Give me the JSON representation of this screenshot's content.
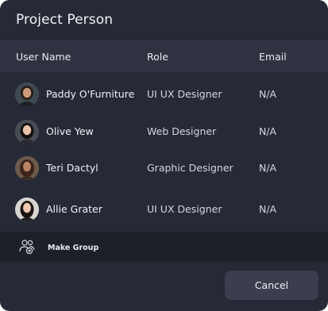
{
  "dialog": {
    "title": "Project Person",
    "columns": {
      "name": "User Name",
      "role": "Role",
      "email": "Email"
    },
    "rows": [
      {
        "name": "Paddy O'Furniture",
        "role": "UI UX Designer",
        "email": "N/A",
        "avatar_bg": "#3d4a52",
        "skin": "#c99a7c",
        "hair": "#2a1c16"
      },
      {
        "name": "Olive Yew",
        "role": "Web Designer",
        "email": "N/A",
        "avatar_bg": "#4a4c55",
        "skin": "#e8c4a8",
        "hair": "#15110f"
      },
      {
        "name": "Teri Dactyl",
        "role": "Graphic Designer",
        "email": "N/A",
        "avatar_bg": "#6e5a4c",
        "skin": "#b98464",
        "hair": "#3a2418"
      },
      {
        "name": "Allie Grater",
        "role": "UI UX Designer",
        "email": "N/A",
        "avatar_bg": "#d9d6d2",
        "skin": "#ecc9af",
        "hair": "#1b1512"
      }
    ],
    "group_action": {
      "label": "Make Group",
      "icon": "group-add-icon"
    },
    "cancel_label": "Cancel"
  },
  "colors": {
    "background": "#262936",
    "header_bg": "#2f3240",
    "footer_bg": "#1e2029",
    "button_bg": "#3a3e4e"
  }
}
